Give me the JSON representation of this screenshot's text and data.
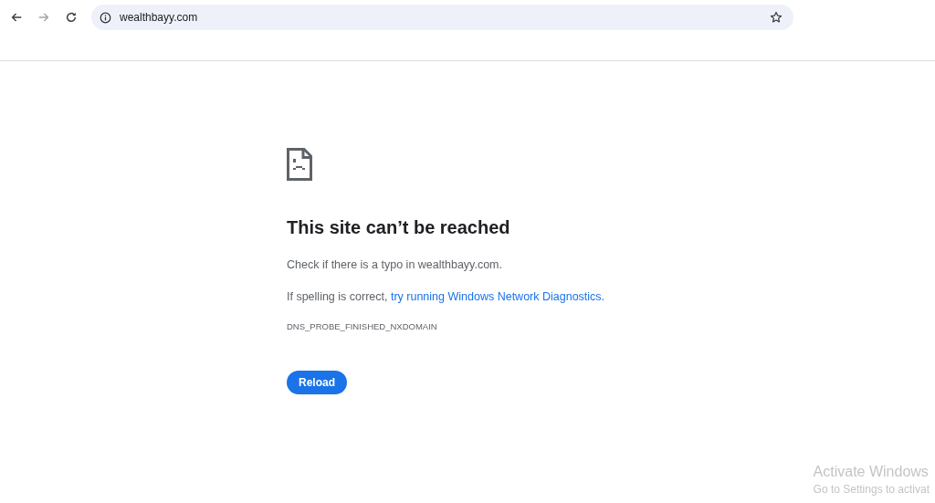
{
  "toolbar": {
    "nav_buttons": [
      {
        "kind": "back",
        "disabled": false
      },
      {
        "kind": "forward",
        "disabled": true
      },
      {
        "kind": "reload",
        "disabled": false
      }
    ],
    "address": "wealthbayy.com",
    "bookmarked": false
  },
  "error": {
    "title": "This site can’t be reached",
    "line_1": "Check if there is a typo in wealthbayy.com.",
    "line_2_prefix": "If spelling is correct, ",
    "line_2_link": "try running Windows Network Diagnostics.",
    "code": "DNS_PROBE_FINISHED_NXDOMAIN",
    "button": "Reload"
  },
  "os_notice": {
    "title": "Activate Windows",
    "subtitle": "Go to Settings to activat"
  }
}
